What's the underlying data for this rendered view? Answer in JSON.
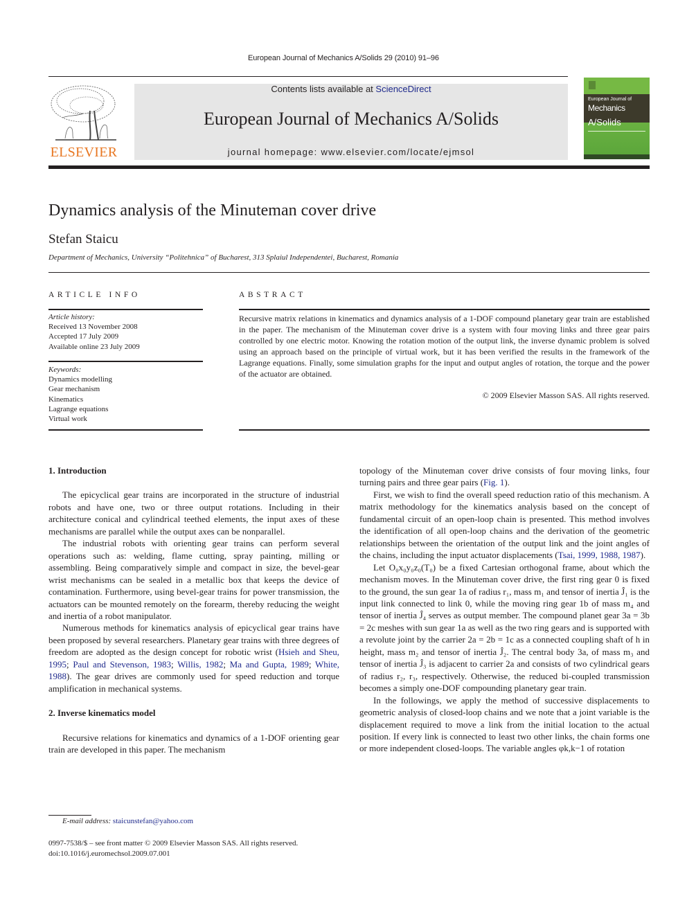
{
  "header": {
    "running_head": "European Journal of Mechanics A/Solids 29 (2010) 91–96",
    "contents_prefix": "Contents lists available at ",
    "contents_link": "ScienceDirect",
    "journal_title": "European Journal of Mechanics A/Solids",
    "homepage": "journal homepage: www.elsevier.com/locate/ejmsol",
    "publisher_logo_text": "ELSEVIER",
    "cover": {
      "line1": "European Journal of",
      "line2": "Mechanics",
      "line3": "A/Solids"
    },
    "colors": {
      "elsevier_orange": "#e87722",
      "link_blue": "#1f2a8c",
      "banner_gray": "#e6e6e6",
      "cover_green": "#6bb33f"
    }
  },
  "article": {
    "title": "Dynamics analysis of the Minuteman cover drive",
    "author": "Stefan Staicu",
    "affiliation": "Department of Mechanics, University “Politehnica” of Bucharest, 313 Splaiul Independentei, Bucharest, Romania"
  },
  "article_info": {
    "heading": "ARTICLE INFO",
    "history_label": "Article history:",
    "history": [
      "Received 13 November 2008",
      "Accepted 17 July 2009",
      "Available online 23 July 2009"
    ],
    "keywords_label": "Keywords:",
    "keywords": [
      "Dynamics modelling",
      "Gear mechanism",
      "Kinematics",
      "Lagrange equations",
      "Virtual work"
    ]
  },
  "abstract": {
    "heading": "ABSTRACT",
    "text": "Recursive matrix relations in kinematics and dynamics analysis of a 1-DOF compound planetary gear train are established in the paper. The mechanism of the Minuteman cover drive is a system with four moving links and three gear pairs controlled by one electric motor. Knowing the rotation motion of the output link, the inverse dynamic problem is solved using an approach based on the principle of virtual work, but it has been verified the results in the framework of the Lagrange equations. Finally, some simulation graphs for the input and output angles of rotation, the torque and the power of the actuator are obtained.",
    "copyright": "© 2009 Elsevier Masson SAS. All rights reserved."
  },
  "body": {
    "sec1_heading": "1.  Introduction",
    "intro_p1": "The epicyclical gear trains are incorporated in the structure of industrial robots and have one, two or three output rotations. Including in their architecture conical and cylindrical teethed elements, the input axes of these mechanisms are parallel while the output axes can be nonparallel.",
    "intro_p2": "The industrial robots with orienting gear trains can perform several operations such as: welding, flame cutting, spray painting, milling or assembling. Being comparatively simple and compact in size, the bevel-gear wrist mechanisms can be sealed in a metallic box that keeps the device of contamination. Furthermore, using bevel-gear trains for power transmission, the actuators can be mounted remotely on the forearm, thereby reducing the weight and inertia of a robot manipulator.",
    "intro_p3_before": "Numerous methods for kinematics analysis of epicyclical gear trains have been proposed by several researchers. Planetary gear trains with three degrees of freedom are adopted as the design concept for robotic wrist (",
    "intro_p3_refs": [
      "Hsieh and Sheu, 1995",
      "Paul and Steven­son, 1983",
      "Willis, 1982",
      "Ma and Gupta, 1989",
      "White, 1988"
    ],
    "intro_p3_after": "). The gear drives are commonly used for speed reduction and torque ampli­fication in mechanical systems.",
    "sec2_heading": "2.  Inverse kinematics model",
    "sec2_p1": "Recursive relations for kinematics and dynamics of a 1-DOF orienting gear train are developed in this paper. The mechanism",
    "right_p0_before": "topology of the Minuteman cover drive consists of four moving links, four turning pairs and three gear pairs (",
    "right_p0_ref": "Fig. 1",
    "right_p0_after": ").",
    "right_p1_before": "First, we wish to find the overall speed reduction ratio of this mechanism. A matrix methodology for the kinematics analysis based on the concept of fundamental circuit of an open-loop chain is presented. This method involves the identification of all open-loop chains and the derivation of the geometric relationships between the orientation of the output link and the joint angles of the chains, including the input actuator displacements (",
    "right_p1_ref": "Tsai, 1999, 1988, 1987",
    "right_p1_after": ").",
    "right_p2": "Let O₀x₀y₀z₀(T₀) be a fixed Cartesian orthogonal frame, about which the mechanism moves. In the Minuteman cover drive, the first ring gear 0 is fixed to the ground, the sun gear 1a of radius r₁, mass m₁ and tensor of inertia Ĵ₁ is the input link connected to link 0, while the moving ring gear 1b of mass m₄ and tensor of inertia Ĵ₄ serves as output member. The compound planet gear 3a = 3b = 2c meshes with sun gear 1a as well as the two ring gears and is supported with a revolute joint by the carrier 2a = 2b = 1c as a connected coupling shaft of h in height, mass m₂ and tensor of inertia Ĵ₂. The central body 3a, of mass m₃ and tensor of inertia Ĵ₃ is adjacent to carrier 2a and consists of two cylindrical gears of radius r₂, r₃, respectively. Otherwise, the reduced bi-coupled transmission becomes a simply one-DOF compounding planetary gear train.",
    "right_p3": "In the followings, we apply the method of successive displacements to geometric analysis of closed-loop chains and we note that a joint variable is the displacement required to move a link from the initial location to the actual position. If every link is connected to least two other links, the chain forms one or more independent closed-loops. The variable angles φk,k−1 of rotation"
  },
  "footnote": {
    "label": "E-mail address: ",
    "email": "staicunstefan@yahoo.com"
  },
  "footer": {
    "issn_line": "0997-7538/$ – see front matter © 2009 Elsevier Masson SAS. All rights reserved.",
    "doi": "doi:10.1016/j.euromechsol.2009.07.001"
  }
}
